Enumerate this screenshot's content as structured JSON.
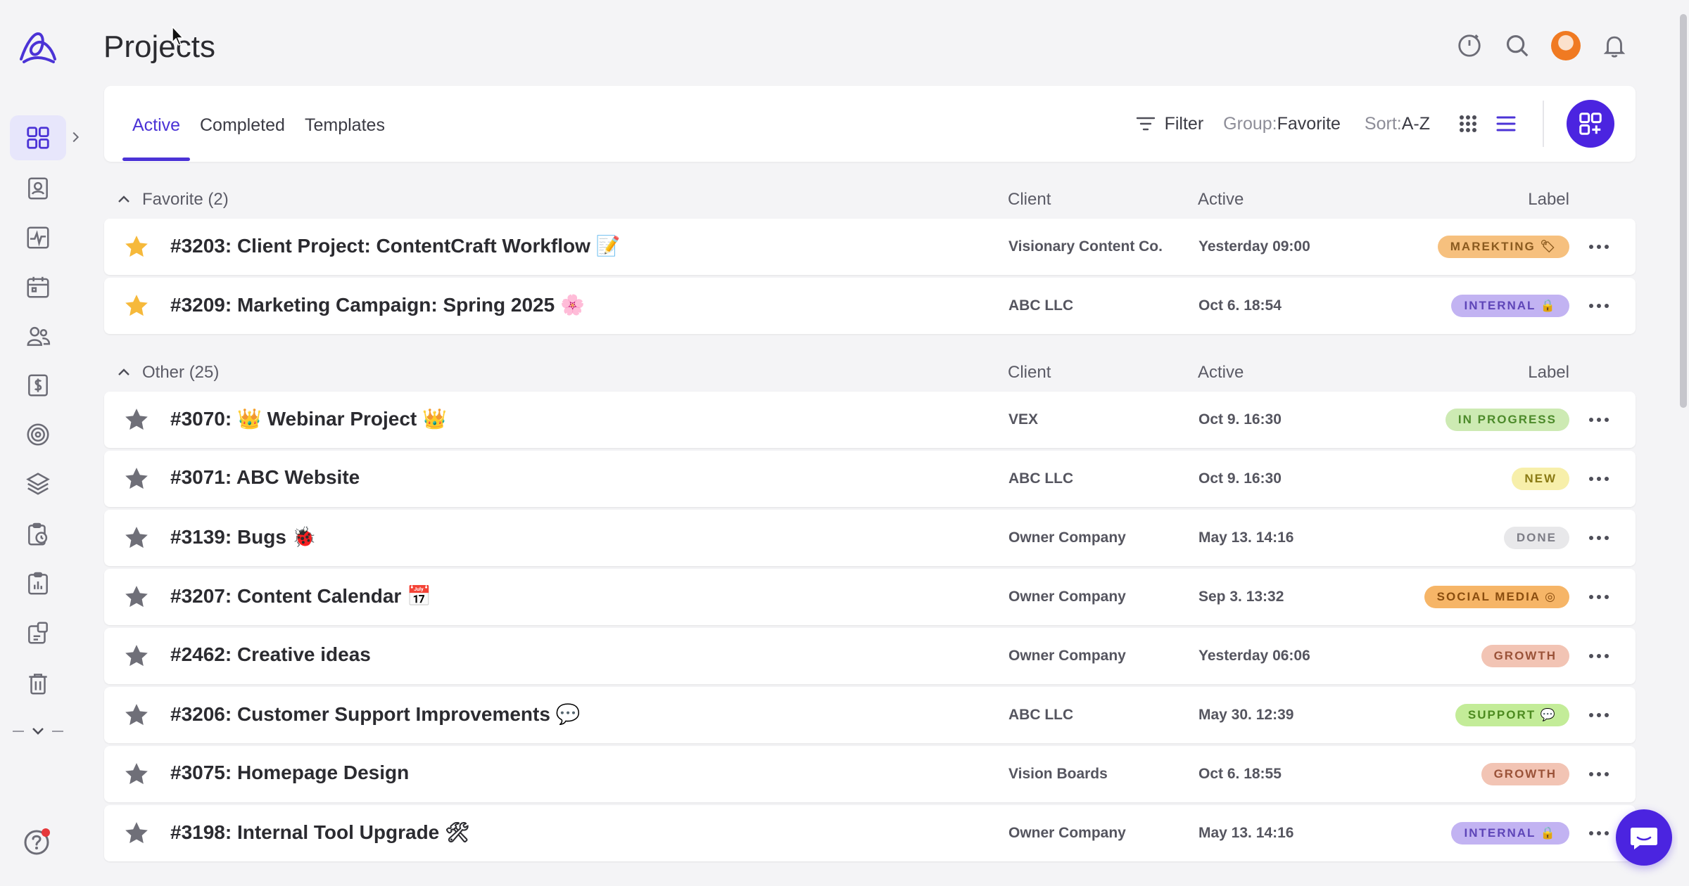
{
  "page": {
    "title": "Projects"
  },
  "tabs": [
    {
      "label": "Active"
    },
    {
      "label": "Completed"
    },
    {
      "label": "Templates"
    }
  ],
  "toolbar": {
    "filter_label": "Filter",
    "group_key": "Group:",
    "group_value": "Favorite",
    "sort_key": "Sort:",
    "sort_value": "A-Z"
  },
  "columns": {
    "client": "Client",
    "active": "Active",
    "label": "Label"
  },
  "favorite_section": {
    "title": "Favorite (2)",
    "rows": [
      {
        "name": "#3203: Client Project: ContentCraft Workflow 📝",
        "client": "Visionary Content Co.",
        "active": "Yesterday 09:00",
        "label": "MAREKTING 🏷",
        "starred": true,
        "label_color": "#f6c07e",
        "label_text_color": "#8a5a1f"
      },
      {
        "name": "#3209: Marketing Campaign: Spring 2025 🌸",
        "client": "ABC LLC",
        "active": "Oct 6. 18:54",
        "label": "INTERNAL 🔒",
        "starred": true,
        "label_color": "#c2b3f2",
        "label_text_color": "#5e45b8"
      }
    ]
  },
  "other_section": {
    "title": "Other (25)",
    "rows": [
      {
        "name": "#3070: 👑 Webinar Project 👑",
        "client": "VEX",
        "active": "Oct 9. 16:30",
        "label": "IN PROGRESS",
        "starred": false,
        "label_color": "#cdeab3",
        "label_text_color": "#4c8a2a"
      },
      {
        "name": "#3071: ABC Website",
        "client": "ABC LLC",
        "active": "Oct 9. 16:30",
        "label": "NEW",
        "starred": false,
        "label_color": "#f7efaa",
        "label_text_color": "#8a7a14"
      },
      {
        "name": "#3139: Bugs 🐞",
        "client": "Owner Company",
        "active": "May 13. 14:16",
        "label": "DONE",
        "starred": false,
        "label_color": "#e8e8ea",
        "label_text_color": "#7d7d86"
      },
      {
        "name": "#3207: Content Calendar 📅",
        "client": "Owner Company",
        "active": "Sep 3. 13:32",
        "label": "SOCIAL MEDIA ◎",
        "starred": false,
        "label_color": "#f6b567",
        "label_text_color": "#8a4d0f"
      },
      {
        "name": "#2462: Creative ideas",
        "client": "Owner Company",
        "active": "Yesterday 06:06",
        "label": "GROWTH",
        "starred": false,
        "label_color": "#f2c4b4",
        "label_text_color": "#9a5238"
      },
      {
        "name": "#3206: Customer Support Improvements 💬",
        "client": "ABC LLC",
        "active": "May 30. 12:39",
        "label": "SUPPORT 💬",
        "starred": false,
        "label_color": "#c3ec98",
        "label_text_color": "#4c8a1f"
      },
      {
        "name": "#3075: Homepage Design",
        "client": "Vision Boards",
        "active": "Oct 6. 18:55",
        "label": "GROWTH",
        "starred": false,
        "label_color": "#f2c4b4",
        "label_text_color": "#9a5238"
      },
      {
        "name": "#3198: Internal Tool Upgrade 🛠",
        "client": "Owner Company",
        "active": "May 13. 14:16",
        "label": "INTERNAL 🔒",
        "starred": false,
        "label_color": "#c2b3f2",
        "label_text_color": "#5e45b8"
      }
    ]
  },
  "colors": {
    "accent": "#4b24e0",
    "star_favorite": "#f6b93b",
    "star_default": "#6f6f78"
  }
}
